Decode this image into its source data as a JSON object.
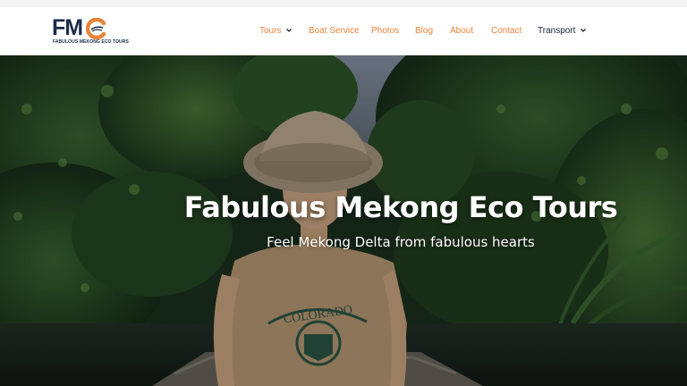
{
  "header": {
    "logo_text": "FMC",
    "logo_tagline": "FABULOUS MEKONG ECO TOURS",
    "nav": [
      {
        "label": "Tours",
        "has_dropdown": true,
        "color": "#e8843a"
      },
      {
        "label": "Boat Service",
        "has_dropdown": false,
        "color": "#e8843a"
      },
      {
        "label": "Photos",
        "has_dropdown": false,
        "color": "#e8843a"
      },
      {
        "label": "Blog",
        "has_dropdown": false,
        "color": "#e8843a"
      },
      {
        "label": "About",
        "has_dropdown": false,
        "color": "#e8843a"
      },
      {
        "label": "Contact",
        "has_dropdown": false,
        "color": "#e8843a"
      },
      {
        "label": "Transport",
        "has_dropdown": true,
        "color": "#1e2230"
      }
    ]
  },
  "hero": {
    "title": "Fabulous Mekong Eco Tours",
    "subtitle": "Feel Mekong Delta from fabulous hearts",
    "shirt_text": "COLORADO",
    "image_description_icon": "hero-photo"
  },
  "colors": {
    "accent": "#e8843a",
    "logo_navy": "#1c2b4a",
    "text_dark": "#1e2230"
  }
}
